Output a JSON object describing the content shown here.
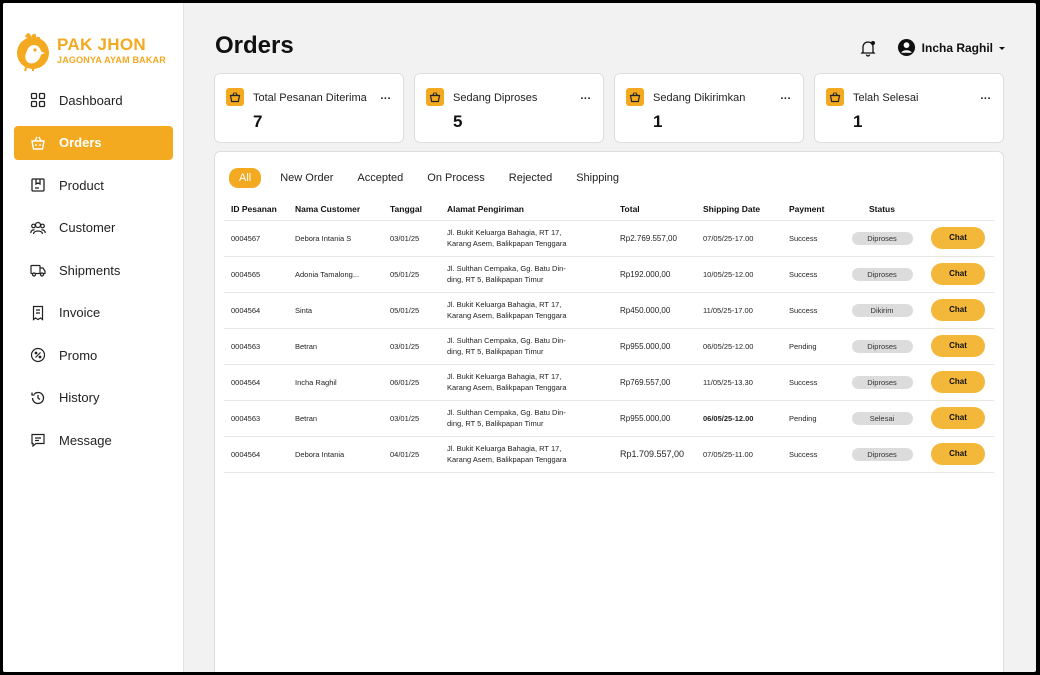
{
  "brand": {
    "title": "PAK JHON",
    "subtitle": "JAGONYA AYAM BAKAR",
    "accent": "#f3a920"
  },
  "nav": [
    {
      "label": "Dashboard",
      "icon": "grid-icon",
      "active": false
    },
    {
      "label": "Orders",
      "icon": "basket-icon",
      "active": true
    },
    {
      "label": "Product",
      "icon": "box-icon",
      "active": false
    },
    {
      "label": "Customer",
      "icon": "users-icon",
      "active": false
    },
    {
      "label": "Shipments",
      "icon": "truck-icon",
      "active": false
    },
    {
      "label": "Invoice",
      "icon": "receipt-icon",
      "active": false
    },
    {
      "label": "Promo",
      "icon": "percent-icon",
      "active": false
    },
    {
      "label": "History",
      "icon": "history-icon",
      "active": false
    },
    {
      "label": "Message",
      "icon": "message-icon",
      "active": false
    }
  ],
  "header": {
    "title": "Orders",
    "user_name": "Incha Raghil"
  },
  "stats": [
    {
      "label": "Total Pesanan Diterima",
      "value": "7"
    },
    {
      "label": "Sedang Diproses",
      "value": "5"
    },
    {
      "label": "Sedang Dikirimkan",
      "value": "1"
    },
    {
      "label": "Telah Selesai",
      "value": "1"
    }
  ],
  "stat_more": "...",
  "tabs": [
    "All",
    "New Order",
    "Accepted",
    "On Process",
    "Rejected",
    "Shipping"
  ],
  "table": {
    "columns": [
      "ID Pesanan",
      "Nama Customer",
      "Tanggal",
      "Alamat Pengiriman",
      "Total",
      "Shipping Date",
      "Payment",
      "Status"
    ],
    "rows": [
      {
        "id": "0004567",
        "customer": "Debora Intania S",
        "date": "03/01/25",
        "address1": "Jl. Bukit Keluarga Bahagia, RT 17,",
        "address2": "Karang Asem, Balikpapan Tenggara",
        "total": "Rp2.769.557,00",
        "shipping": "07/05/25-17.00",
        "payment": "Success",
        "status": "Diproses",
        "action": "Chat"
      },
      {
        "id": "0004565",
        "customer": "Adonia Tamalong...",
        "date": "05/01/25",
        "address1": "Jl. Sulthan Cempaka, Gg. Batu Din-",
        "address2": "ding, RT 5, Balikpapan Timur",
        "total": "Rp192.000,00",
        "shipping": "10/05/25-12.00",
        "payment": "Success",
        "status": "Diproses",
        "action": "Chat"
      },
      {
        "id": "0004564",
        "customer": "Sinta",
        "date": "05/01/25",
        "address1": "Jl. Bukit Keluarga Bahagia, RT 17,",
        "address2": "Karang Asem, Balikpapan Tenggara",
        "total": "Rp450.000,00",
        "shipping": "11/05/25-17.00",
        "payment": "Success",
        "status": "Dikirim",
        "action": "Chat"
      },
      {
        "id": "0004563",
        "customer": "Betran",
        "date": "03/01/25",
        "address1": "Jl. Sulthan Cempaka, Gg. Batu Din-",
        "address2": "ding, RT 5, Balikpapan Timur",
        "total": "Rp955.000,00",
        "shipping": "06/05/25-12.00",
        "payment": "Pending",
        "status": "Diproses",
        "action": "Chat"
      },
      {
        "id": "0004564",
        "customer": "Incha Raghil",
        "date": "06/01/25",
        "address1": "Jl. Bukit Keluarga Bahagia, RT 17,",
        "address2": "Karang Asem, Balikpapan Tenggara",
        "total": "Rp769.557,00",
        "shipping": "11/05/25-13.30",
        "payment": "Success",
        "status": "Diproses",
        "action": "Chat"
      },
      {
        "id": "0004563",
        "customer": "Betran",
        "date": "03/01/25",
        "address1": "Jl. Sulthan Cempaka, Gg. Batu Din-",
        "address2": "ding, RT 5, Balikpapan Timur",
        "total": "Rp955.000,00",
        "shipping": "06/05/25-12.00",
        "payment": "Pending",
        "status": "Selesai",
        "action": "Chat"
      },
      {
        "id": "0004564",
        "customer": "Debora Intania",
        "date": "04/01/25",
        "address1": "Jl. Bukit Keluarga Bahagia, RT 17,",
        "address2": "Karang Asem, Balikpapan Tenggara",
        "total": "Rp1.709.557,00",
        "shipping": "07/05/25-11.00",
        "payment": "Success",
        "status": "Diproses",
        "action": "Chat"
      }
    ]
  }
}
